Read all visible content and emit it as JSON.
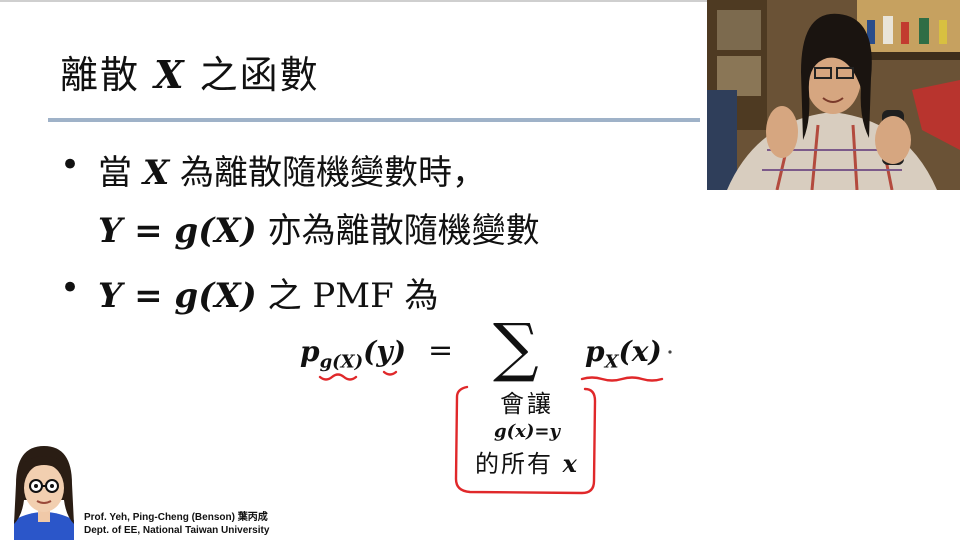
{
  "slide": {
    "title_pre": "離散 ",
    "title_var": "X",
    "title_post": " 之函數",
    "bullet1_line1_pre": "當 ",
    "bullet1_line1_var": "X",
    "bullet1_line1_post": " 為離散隨機變數時，",
    "bullet1_line2_math": "Y = g(X)",
    "bullet1_line2_text": " 亦為離散隨機變數",
    "bullet2_math": "Y = g(X)",
    "bullet2_text": " 之 PMF 為",
    "bullet_symbol": "•"
  },
  "formula": {
    "lhs_p": "p",
    "lhs_sub": "g(X)",
    "lhs_arg": "(y)",
    "equals": "=",
    "sum": "∑",
    "rhs_p": "p",
    "rhs_sub": "X",
    "rhs_arg": "(x)"
  },
  "handwritten": {
    "line1": "會讓",
    "line2": "g(x)=y",
    "line3_text": "的所有 ",
    "line3_var": "x"
  },
  "credit": {
    "line1": "Prof. Yeh, Ping-Cheng (Benson) 葉丙成",
    "line2": "Dept. of EE,  National Taiwan University"
  },
  "colors": {
    "title_rule": "#9fb2c8",
    "ink_red": "#e0282a"
  }
}
